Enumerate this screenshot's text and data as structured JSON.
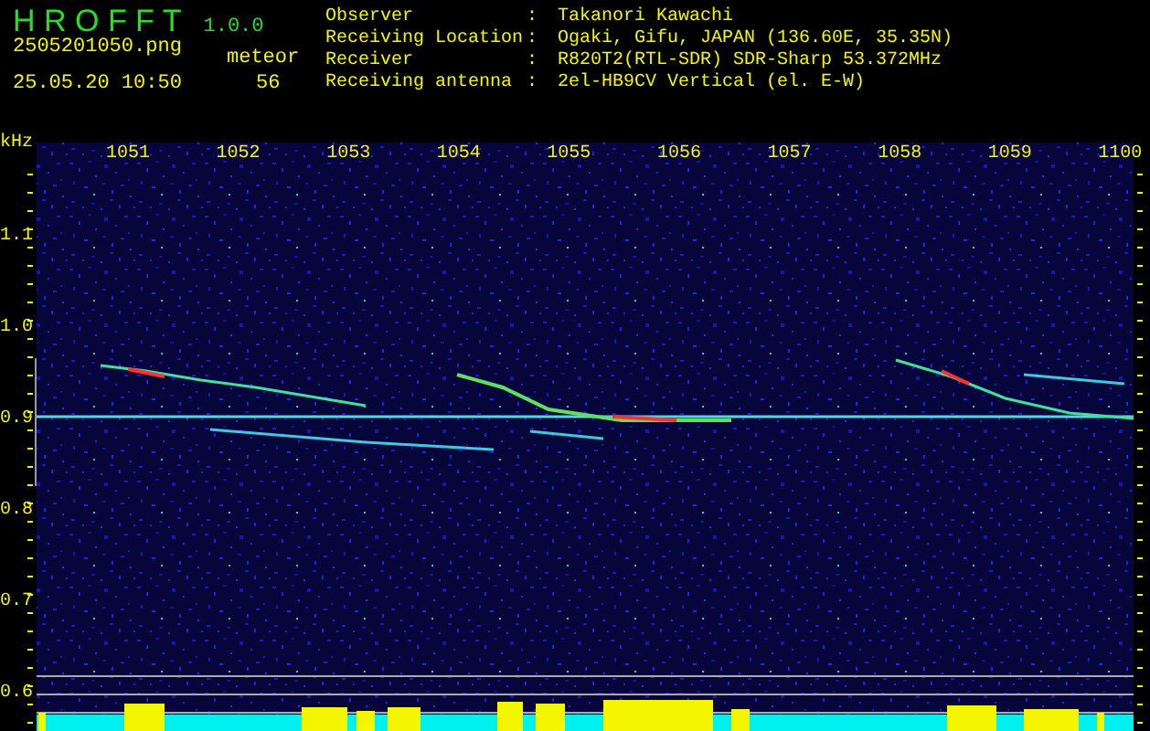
{
  "app": {
    "name": "H R O F F T",
    "version": "1.0.0"
  },
  "file_name": "2505201050.png",
  "timestamp": "25.05.20 10:50",
  "count": {
    "label": "meteor",
    "value": "56"
  },
  "info": [
    {
      "label": "Observer",
      "separator": ":",
      "value": "Takanori Kawachi"
    },
    {
      "label": "Receiving Location",
      "separator": ":",
      "value": "Ogaki, Gifu, JAPAN (136.60E, 35.35N)"
    },
    {
      "label": "Receiver",
      "separator": ":",
      "value": "R820T2(RTL-SDR) SDR-Sharp 53.372MHz"
    },
    {
      "label": "Receiving antenna",
      "separator": ":",
      "value": "2el-HB9CV Vertical (el. E-W)"
    }
  ],
  "y_unit": "kHz",
  "x_labels": [
    "1051",
    "1052",
    "1053",
    "1054",
    "1055",
    "1056",
    "1057",
    "1058",
    "1059",
    "1100"
  ],
  "y_labels": [
    "1.1",
    "1.0",
    "0.9",
    "0.8",
    "0.7",
    "0.6"
  ]
}
